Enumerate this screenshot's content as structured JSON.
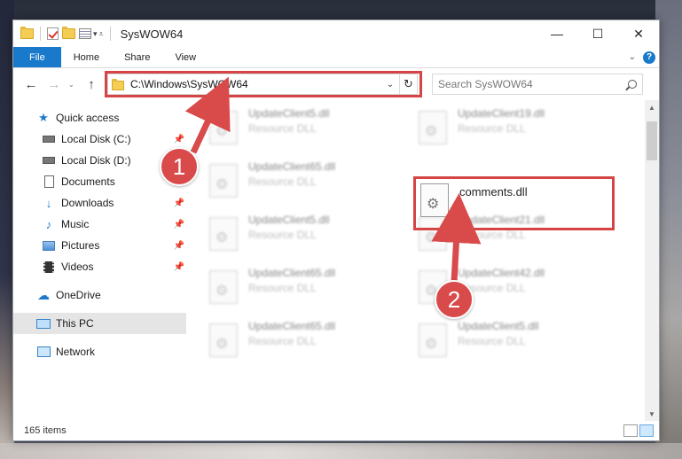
{
  "window": {
    "title": "SysWOW64",
    "controls": {
      "minimize": "—",
      "maximize": "☐",
      "close": "✕"
    }
  },
  "ribbon": {
    "tabs": [
      "File",
      "Home",
      "Share",
      "View"
    ],
    "help": "?"
  },
  "navbar": {
    "address": "C:\\Windows\\SysWOW64",
    "search_placeholder": "Search SysWOW64"
  },
  "sidebar": {
    "quick_access": "Quick access",
    "items": [
      {
        "label": "Local Disk (C:)",
        "pinned": true
      },
      {
        "label": "Local Disk (D:)",
        "pinned": true
      },
      {
        "label": "Documents",
        "pinned": true
      },
      {
        "label": "Downloads",
        "pinned": true
      },
      {
        "label": "Music",
        "pinned": true
      },
      {
        "label": "Pictures",
        "pinned": true
      },
      {
        "label": "Videos",
        "pinned": true
      }
    ],
    "onedrive": "OneDrive",
    "this_pc": "This PC",
    "network": "Network"
  },
  "files": {
    "left_column": [
      {
        "name": "UpdateClient5.dll",
        "desc": "Resource DLL"
      },
      {
        "name": "UpdateClient65.dll",
        "desc": "Resource DLL"
      },
      {
        "name": "UpdateClient5.dll",
        "desc": "Resource DLL"
      },
      {
        "name": "UpdateClient65.dll",
        "desc": "Resource DLL"
      },
      {
        "name": "UpdateClient65.dll",
        "desc": "Resource DLL"
      }
    ],
    "right_column": [
      {
        "name": "UpdateClient19.dll",
        "desc": "Resource DLL"
      },
      {
        "name": "comments.dll",
        "desc": ""
      },
      {
        "name": "UpdateClient21.dll",
        "desc": "Resource DLL"
      },
      {
        "name": "UpdateClient42.dll",
        "desc": "Resource DLL"
      },
      {
        "name": "UpdateClient5.dll",
        "desc": "Resource DLL"
      }
    ],
    "highlighted": "comments.dll"
  },
  "status": {
    "item_count": "165 items"
  },
  "annotations": {
    "step1": "1",
    "step2": "2",
    "highlight_color": "#d64545"
  }
}
